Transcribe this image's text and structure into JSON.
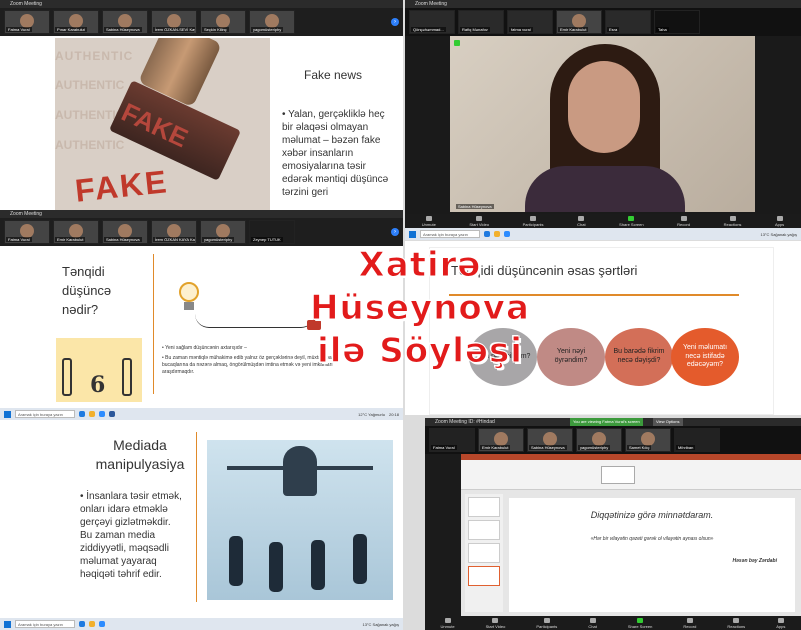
{
  "windows": {
    "w1_title": "Zoom Meeting",
    "w2_title": "Zoom Meeting",
    "w3_title": "Zoom Meeting",
    "w5_title": "Zoom Meeting ID: #Hindad"
  },
  "panel1": {
    "participants": [
      "Fatma Vural",
      "Pınar Karabulut",
      "Sabina Hüseynova",
      "İrem ÖZKAN-SEVİ Kaya",
      "Seçkin Kilinç",
      "yagomüsteriphy"
    ],
    "slide_title": "Fake news",
    "bullet": "Yalan, gerçəkliklə heç bir əlaqəsi olmayan məlumat – bəzən fake xəbər insanların emosiyalarına təsir edərək məntiqi düşüncə tərzini geri",
    "stamp_text": "FAKE",
    "stamp_bg_text": "AUTHENTIC"
  },
  "panel2": {
    "participants": [
      "Qönçəhəmmad...",
      "Rafiq Mənafov",
      "fatma vural",
      "Emir Karabulut",
      "Esra",
      "Taha"
    ],
    "self_label": "Sabina Hüseynova",
    "toolbar": [
      "Unmute",
      "Start Video",
      "Participants",
      "Chat",
      "Share Screen",
      "Record",
      "Reactions",
      "Apps"
    ],
    "participant_count": "17"
  },
  "panel3": {
    "participants": [
      "Fatma Vural",
      "Emir Karabulut",
      "Sabina Hüseynova",
      "İrem ÖZKAN KAYA Kaya",
      "yagomüsteriphy",
      "Zeynep TUTUK"
    ],
    "slide_title": "Tənqidi düşüncə nədir?",
    "bullets": [
      "Yeni sağlam düşüncənin axtarışıdır –",
      "Bu zaman məntiqlə mühakimə edib yalnız öz gerçəklərinə deyil, müxtəlif baxış bucaqlarına da nəzərə almaq, öngörülmüşdən imtina etmək və yeni imkanları araşdırmaqdır."
    ]
  },
  "panel4": {
    "slide_title": "Tənqidi düşüncənin əsas şərtləri",
    "circles": [
      "Mən nəyi bilirəm?",
      "Yeni nəyi öyrəndim?",
      "Bu barədə fikrim necə dəyişdi?",
      "Yeni məlumatı necə istifadə edəcəyəm?"
    ],
    "circle_colors": [
      "#a8a6a8",
      "#c08a85",
      "#d36f58",
      "#e45b2c"
    ]
  },
  "panel5": {
    "slide_title": "Mediada manipulyasiya",
    "bullet": "İnsanlara təsir etmək, onları idarə etməklə gerçəyi gizlətməkdir. Bu zaman media ziddiyyətli, məqsədli məlumat yayaraq həqiqəti təhrif edir."
  },
  "panel6": {
    "participants": [
      "Fatma Vural",
      "Emir Karabulut",
      "Sabina Hüseynova",
      "yagomüsteriphy",
      "Samet Kılıç",
      "Mihriban"
    ],
    "banner": "You are viewing Fatma Vural's screen",
    "view_options": "View Options",
    "slide_heading": "Diqqətinizə görə minnətdaram.",
    "quote": "«Hər bir vilayətin qəzeti gərək ol vilayətin aynası olsun»",
    "author": "Həsən bəy Zərdabi",
    "toolbar": [
      "Unmute",
      "Start Video",
      "Participants",
      "Chat",
      "Share Screen",
      "Record",
      "Reactions",
      "Apps"
    ]
  },
  "taskbar": {
    "search_placeholder": "Aramak için buraya yazın",
    "weather1": "12°C Yağmurlu",
    "weather2": "13°C Sağanak yağış",
    "time": "20:18"
  },
  "overlay": {
    "line1": "Xatirə",
    "line2": "Hüseynova",
    "line3": "ilə Söyləşi",
    "color": "#e21b1b"
  }
}
